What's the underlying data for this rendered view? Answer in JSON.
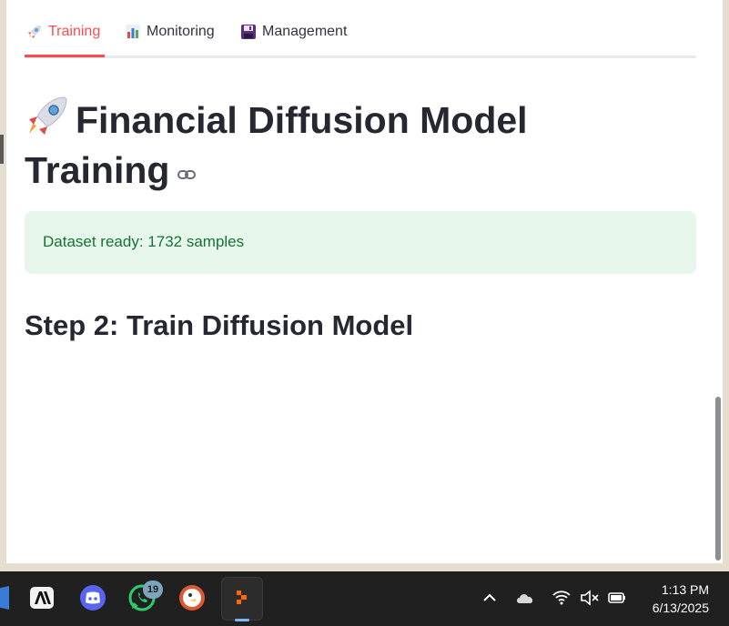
{
  "tabs": [
    {
      "label": "Training",
      "icon": "rocket-icon",
      "active": true
    },
    {
      "label": "Monitoring",
      "icon": "bar-chart-icon",
      "active": false
    },
    {
      "label": "Management",
      "icon": "floppy-disk-icon",
      "active": false
    }
  ],
  "page": {
    "title": "Financial Diffusion Model Training",
    "title_icon": "rocket-icon",
    "anchor_icon": "link-icon"
  },
  "alert": {
    "text": "Dataset ready: 1732 samples",
    "color": "#177233",
    "background": "#e8f7ec"
  },
  "section": {
    "title": "Step 2: Train Diffusion Model"
  },
  "colors": {
    "accent": "#ff4b4b",
    "text": "#262730"
  },
  "taskbar": {
    "apps": [
      {
        "name": "partial-app-icon"
      },
      {
        "name": "anthropic-app-icon"
      },
      {
        "name": "discord-icon"
      },
      {
        "name": "whatsapp-icon",
        "badge": "19"
      },
      {
        "name": "duckduckgo-icon"
      },
      {
        "name": "active-app-icon",
        "active": true
      }
    ],
    "tray": [
      "chevron-up-icon",
      "cloud-icon",
      "wifi-icon",
      "volume-muted-icon",
      "battery-icon"
    ],
    "time": "1:13 PM",
    "date": "6/13/2025"
  }
}
